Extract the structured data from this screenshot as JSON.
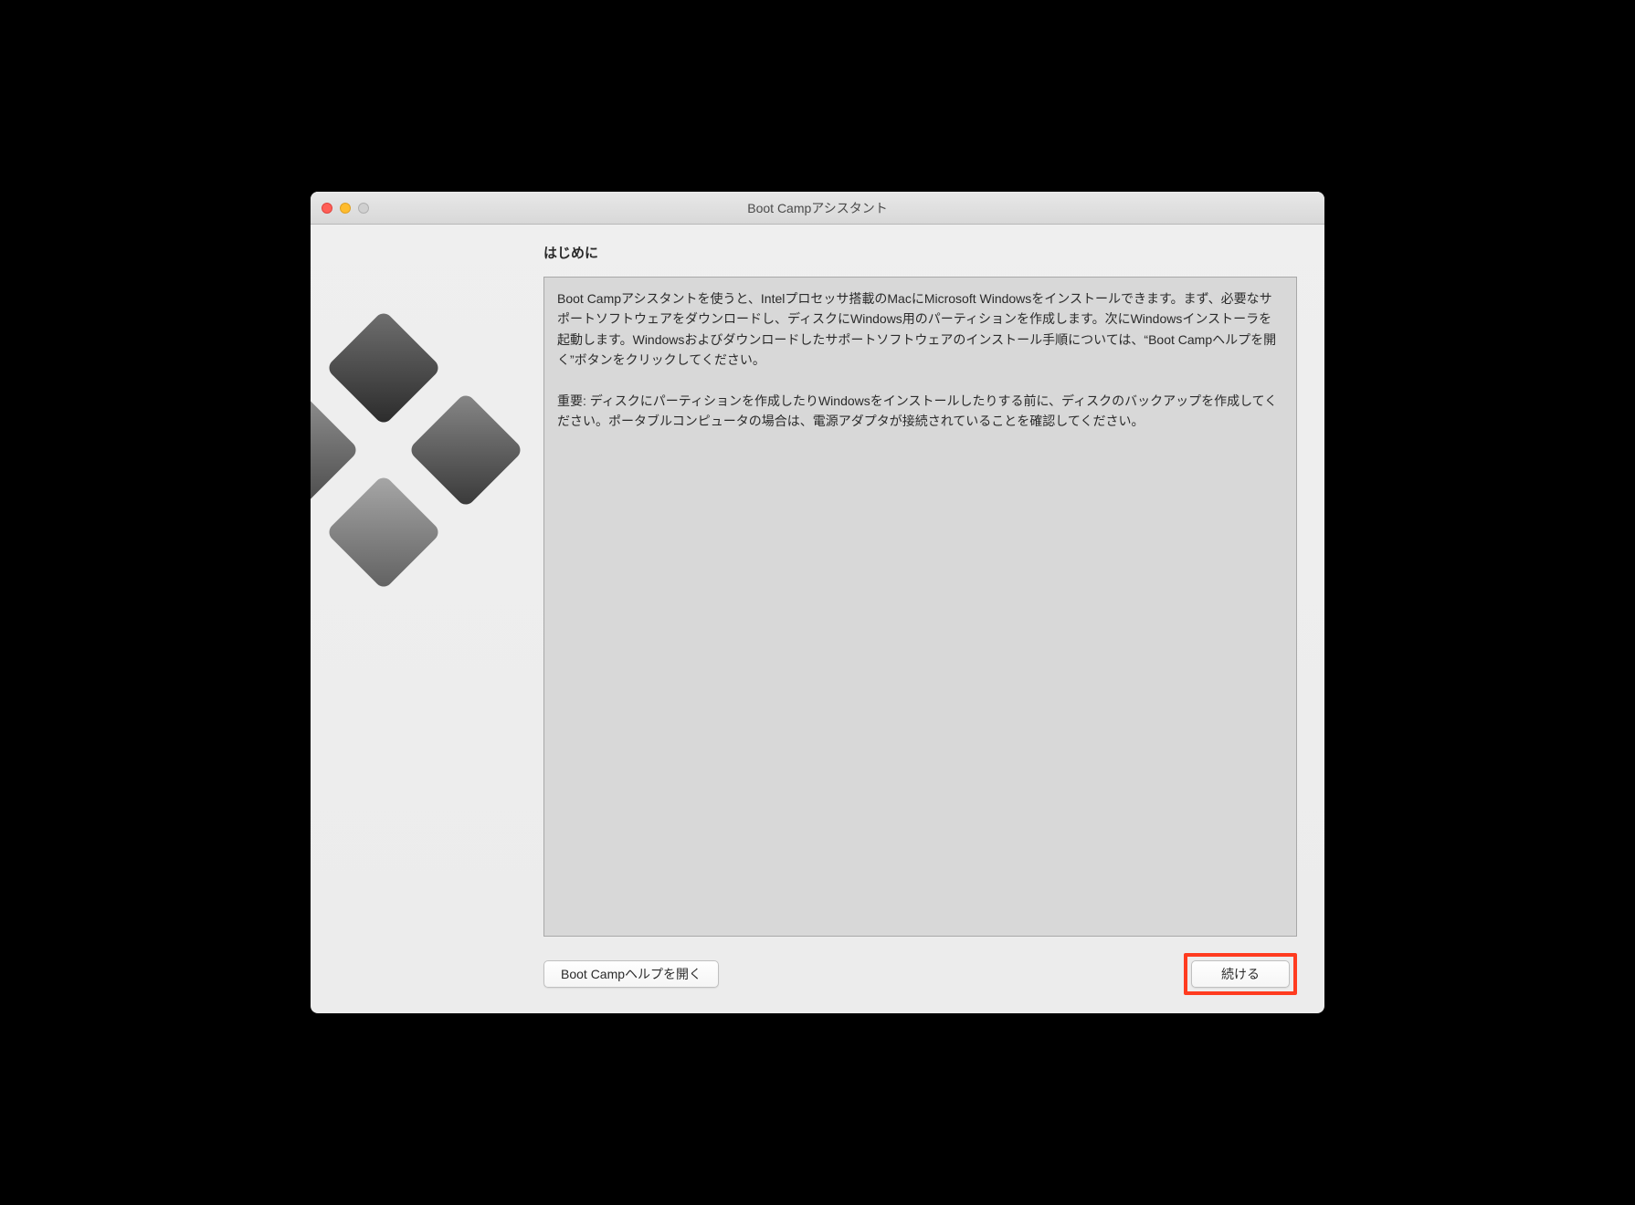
{
  "window": {
    "title": "Boot Campアシスタント"
  },
  "heading": "はじめに",
  "body": {
    "paragraph1": "Boot Campアシスタントを使うと、Intelプロセッサ搭載のMacにMicrosoft Windowsをインストールできます。まず、必要なサポートソフトウェアをダウンロードし、ディスクにWindows用のパーティションを作成します。次にWindowsインストーラを起動します。Windowsおよびダウンロードしたサポートソフトウェアのインストール手順については、“Boot Campヘルプを開く”ボタンをクリックしてください。",
    "paragraph2": "重要: ディスクにパーティションを作成したりWindowsをインストールしたりする前に、ディスクのバックアップを作成してください。ポータブルコンピュータの場合は、電源アダプタが接続されていることを確認してください。"
  },
  "buttons": {
    "help": "Boot Campヘルプを開く",
    "continue": "続ける"
  }
}
